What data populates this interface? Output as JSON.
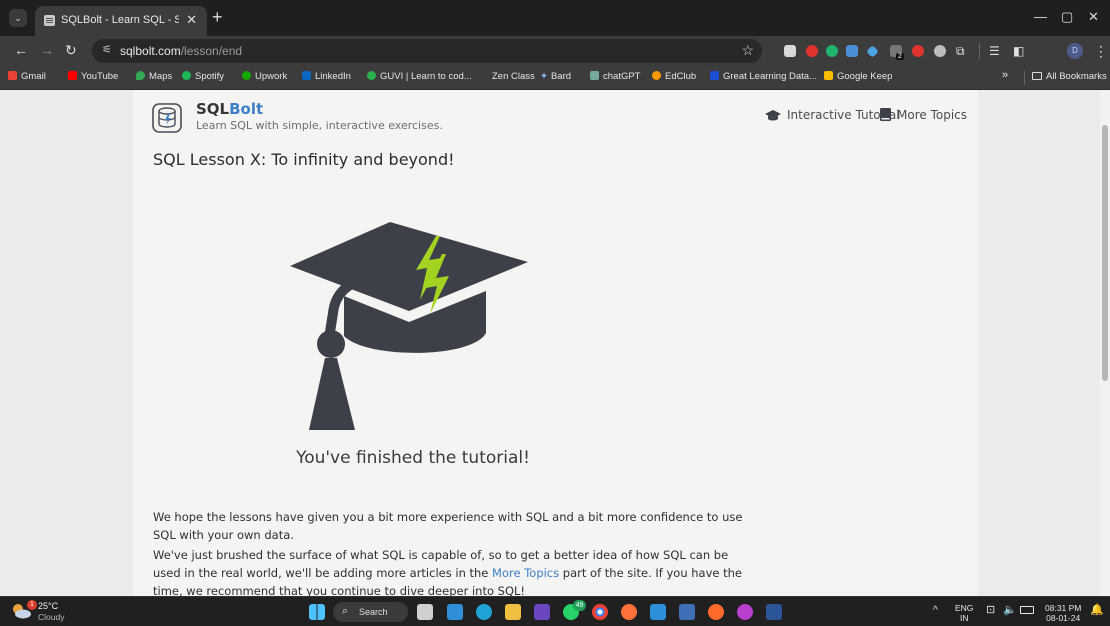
{
  "browser": {
    "tab_title": "SQLBolt - Learn SQL - SQL Lesson X: To infinity and beyond!",
    "url_host": "sqlbolt.com",
    "url_path": "/lesson/end",
    "profile_initial": "D",
    "extension_badge": "2"
  },
  "bookmarks": [
    {
      "label": "Gmail",
      "color": "#ea4335"
    },
    {
      "label": "YouTube",
      "color": "#ff0000"
    },
    {
      "label": "Maps",
      "color": "#34a853"
    },
    {
      "label": "Spotify",
      "color": "#1db954"
    },
    {
      "label": "Upwork",
      "color": "#14a800"
    },
    {
      "label": "LinkedIn",
      "color": "#0a66c2"
    },
    {
      "label": "GUVI | Learn to cod...",
      "color": "#2bb24c"
    },
    {
      "label": "Zen Class",
      "color": "#444444"
    },
    {
      "label": "Bard",
      "color": "#8ab4f8"
    },
    {
      "label": "chatGPT",
      "color": "#74aa9c"
    },
    {
      "label": "EdClub",
      "color": "#ff9900"
    },
    {
      "label": "Great Learning Data...",
      "color": "#1d4ed8"
    },
    {
      "label": "Google Keep",
      "color": "#fbbc04"
    }
  ],
  "bookmarks_overflow": "»",
  "all_bookmarks_label": "All Bookmarks",
  "site": {
    "brand_plain": "SQL",
    "brand_accent": "Bolt",
    "tagline": "Learn SQL with simple, interactive exercises.",
    "nav_interactive": "Interactive Tutorial",
    "nav_more": "More Topics",
    "lesson_title": "SQL Lesson X: To infinity and beyond!",
    "finished_text": "You've finished the tutorial!",
    "para1": "We hope the lessons have given you a bit more experience with SQL and a bit more confidence to use SQL with your own data.",
    "para2_before": "We've just brushed the surface of what SQL is capable of, so to get a better idea of how SQL can be used in the real world, we'll be adding more articles in the ",
    "para2_link": "More Topics",
    "para2_after": " part of the site. If you have the time, we recommend that you continue to dive deeper into SQL!"
  },
  "taskbar": {
    "temperature": "25°C",
    "condition": "Cloudy",
    "weather_badge": "1",
    "search_label": "Search",
    "whatsapp_badge": "49",
    "lang_top": "ENG",
    "lang_bottom": "IN",
    "time": "08:31 PM",
    "date": "08-01-24"
  },
  "colors": {
    "accent": "#3d7fc6",
    "hat_dark": "#3d4049",
    "bolt_green": "#a3d321"
  }
}
